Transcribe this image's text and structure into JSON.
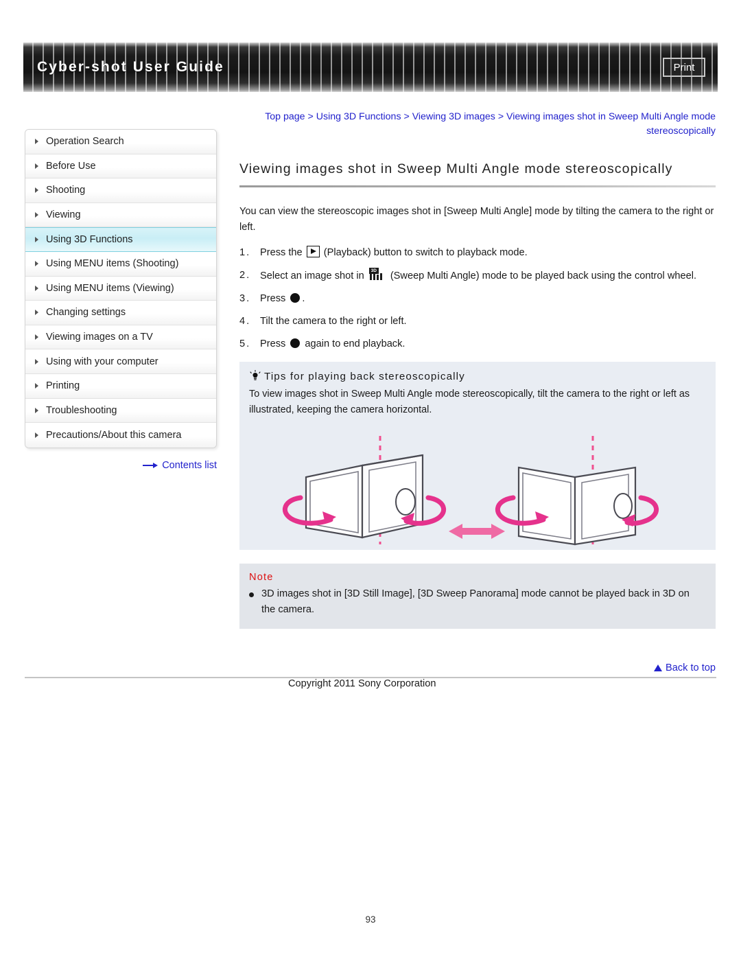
{
  "header": {
    "title": "Cyber-shot User Guide",
    "print_label": "Print"
  },
  "sidebar": {
    "items": [
      {
        "label": "Operation Search",
        "active": false
      },
      {
        "label": "Before Use",
        "active": false
      },
      {
        "label": "Shooting",
        "active": false
      },
      {
        "label": "Viewing",
        "active": false
      },
      {
        "label": "Using 3D Functions",
        "active": true
      },
      {
        "label": "Using MENU items (Shooting)",
        "active": false
      },
      {
        "label": "Using MENU items (Viewing)",
        "active": false
      },
      {
        "label": "Changing settings",
        "active": false
      },
      {
        "label": "Viewing images on a TV",
        "active": false
      },
      {
        "label": "Using with your computer",
        "active": false
      },
      {
        "label": "Printing",
        "active": false
      },
      {
        "label": "Troubleshooting",
        "active": false
      },
      {
        "label": "Precautions/About this camera",
        "active": false
      }
    ],
    "contents_list_label": "Contents list"
  },
  "main": {
    "breadcrumb": "Top page > Using 3D Functions > Viewing 3D images > Viewing images shot in Sweep Multi Angle mode stereoscopically",
    "title": "Viewing images shot in Sweep Multi Angle mode stereoscopically",
    "intro": "You can view the stereoscopic images shot in [Sweep Multi Angle] mode by tilting the camera to the right or left.",
    "steps": [
      {
        "number": "1.",
        "text_before": "Press the ",
        "icon": "playback-icon",
        "text_after": " (Playback) button to switch to playback mode."
      },
      {
        "number": "2.",
        "text_before": "Select an image shot in ",
        "icon": "sweep-multi-angle-3d-icon",
        "text_after": " (Sweep Multi Angle) mode to be played back using the control wheel."
      },
      {
        "number": "3.",
        "text_before": "Press ",
        "icon": "center-button-icon",
        "text_after": "."
      },
      {
        "number": "4.",
        "text_before": "Tilt the camera to the right or left.",
        "icon": "",
        "text_after": ""
      },
      {
        "number": "5.",
        "text_before": "Press ",
        "icon": "center-button-icon",
        "text_after": " again to end playback."
      }
    ],
    "tips": {
      "heading": "Tips for playing back stereoscopically",
      "icon": "lightbulb-icon",
      "body": "To view images shot in Sweep Multi Angle mode stereoscopically, tilt the camera to the right or left as illustrated, keeping the camera horizontal.",
      "illustration_name": "camera-tilt-left-right-illustration"
    },
    "note": {
      "heading": "Note",
      "items": [
        "3D images shot in [3D Still Image], [3D Sweep Panorama] mode cannot be played back in 3D on the camera."
      ]
    }
  },
  "footer": {
    "back_to_top_label": "Back to top",
    "copyright": "Copyright 2011 Sony Corporation",
    "page_number": "93"
  },
  "colors": {
    "link": "#2222cc",
    "accent_pink": "#e5328c",
    "note_red": "#dd1111",
    "tips_bg": "#e9edf3",
    "note_bg": "#e2e5ea",
    "active_nav": "#c9eef6"
  }
}
